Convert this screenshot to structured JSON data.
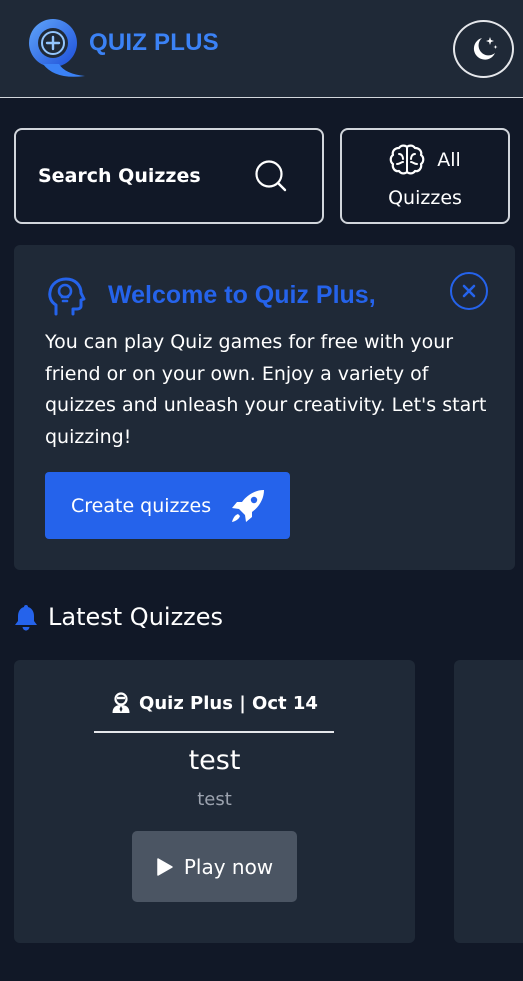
{
  "header": {
    "logo_text": "QUIZ PLUS",
    "theme_toggle_icon": "moon-stars-icon",
    "colors": {
      "brand": "#3b82f6",
      "header_bg": "#1f2937",
      "page_bg": "#111827"
    }
  },
  "search": {
    "label": "Search Quizzes",
    "icon": "search-icon"
  },
  "all_quizzes": {
    "label_line1": "All",
    "label_line2": "Quizzes",
    "icon": "brain-icon"
  },
  "welcome": {
    "title": "Welcome to Quiz Plus,",
    "body": "You can play Quiz games for free with your friend or on your own. Enjoy a variety of quizzes and unleash your creativity. Let's start quizzing!",
    "button_label": "Create quizzes",
    "button_icon": "rocket-icon",
    "accent": "#2563eb"
  },
  "latest": {
    "heading": "Latest Quizzes",
    "icon": "bell-icon",
    "cards": [
      {
        "author_date": "Quiz Plus | Oct 14",
        "title": "test",
        "description": "test",
        "button_label": "Play now"
      }
    ]
  }
}
